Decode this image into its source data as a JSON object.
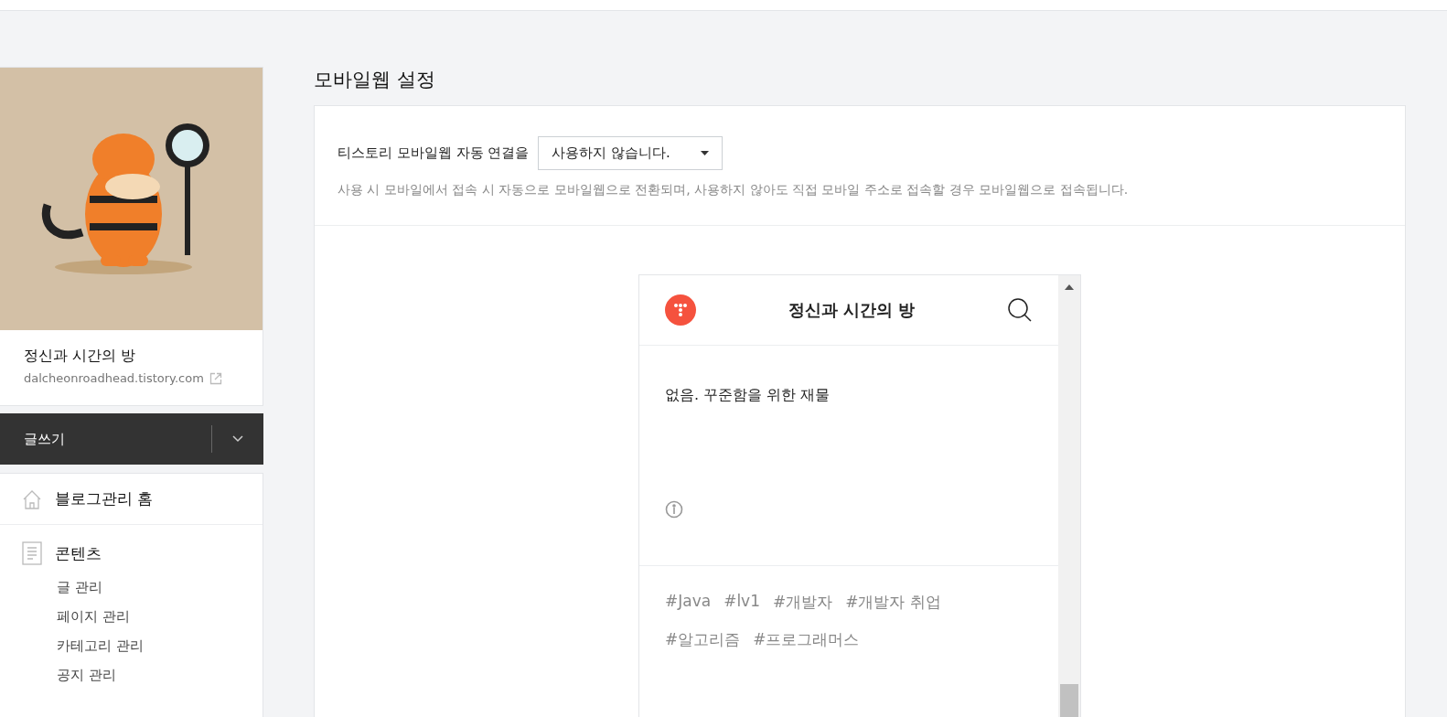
{
  "blog": {
    "name": "정신과 시간의 방",
    "url": "dalcheonroadhead.tistory.com"
  },
  "write_button": {
    "label": "글쓰기"
  },
  "menu": [
    {
      "kind": "home",
      "label": "블로그관리 홈"
    },
    {
      "kind": "document",
      "label": "콘텐츠",
      "items": [
        "글 관리",
        "페이지 관리",
        "카테고리 관리",
        "공지 관리"
      ]
    }
  ],
  "page_title": "모바일웹 설정",
  "setting": {
    "label": "티스토리 모바일웹 자동 연결을",
    "value": "사용하지 않습니다.",
    "help": "사용 시 모바일에서 접속 시 자동으로 모바일웹으로 전환되며, 사용하지 않아도 직접 모바일 주소로 접속할 경우 모바일웹으로 접속됩니다."
  },
  "preview": {
    "blog_title": "정신과 시간의 방",
    "body": "없음. 꾸준함을 위한 재물",
    "tags": [
      "#Java",
      "#lv1",
      "#개발자",
      "#개발자 취업",
      "#알고리즘",
      "#프로그래머스"
    ]
  }
}
